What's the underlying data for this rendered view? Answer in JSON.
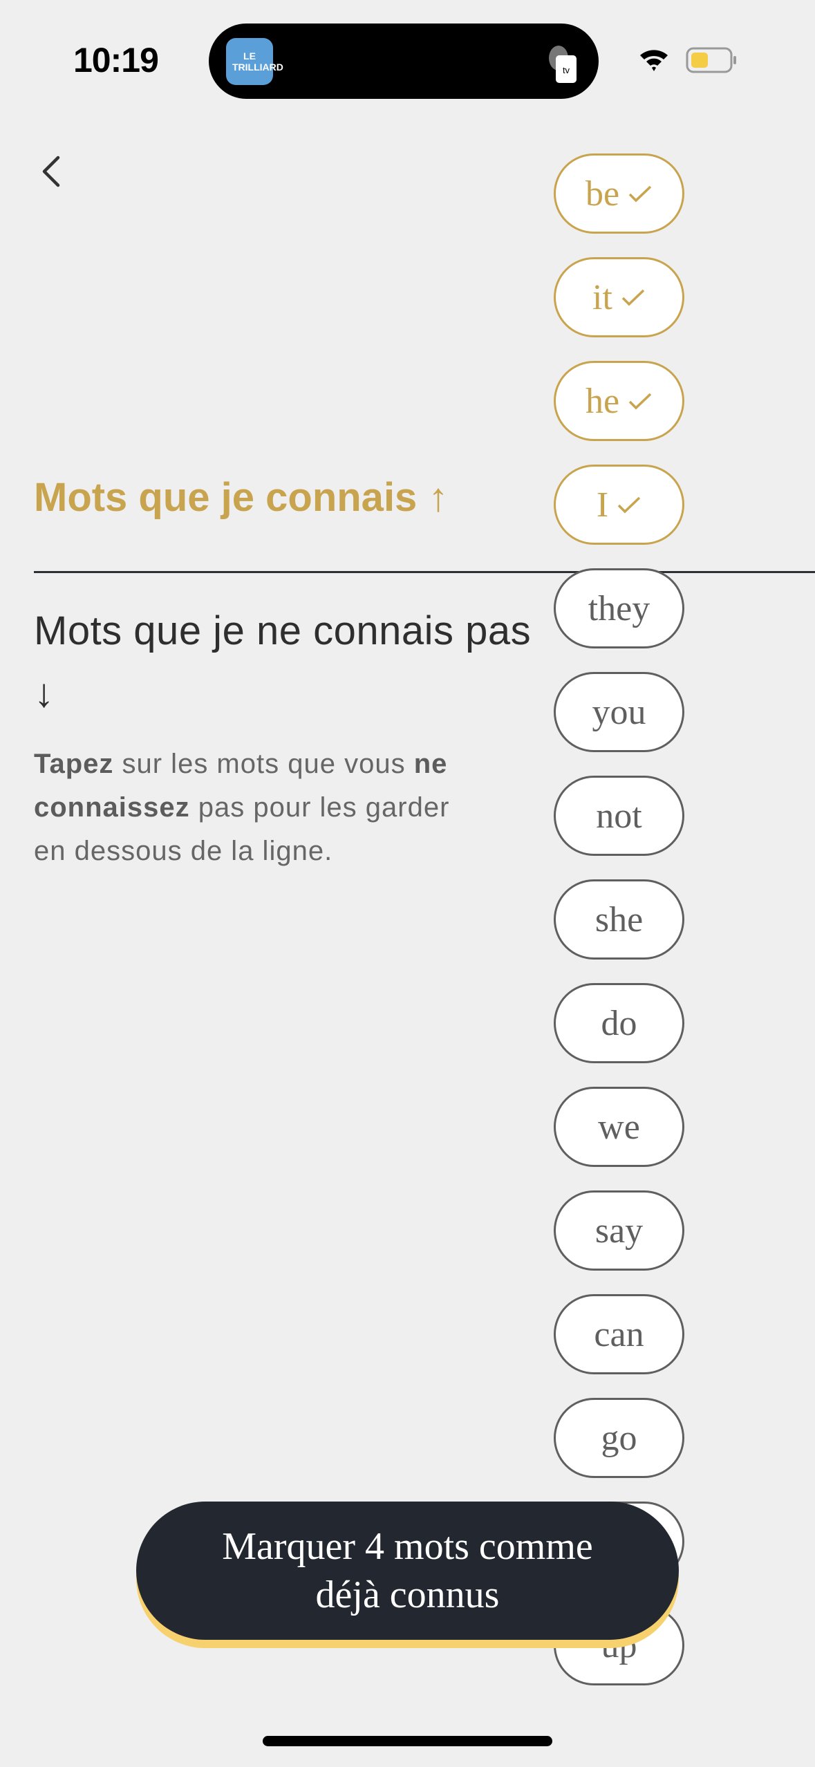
{
  "status_bar": {
    "time": "10:19",
    "app_icon_text": "LE TRILLIARD",
    "tv_badge": "tv"
  },
  "colors": {
    "accent": "#c9a44f",
    "dark": "#23272f",
    "button_shadow": "#f6d16d",
    "background": "#efefef"
  },
  "known_section": {
    "title": "Mots que je connais ↑"
  },
  "unknown_section": {
    "title": "Mots que je ne connais pas ↓",
    "instructions": {
      "b1": "Tapez",
      "t1": " sur les mots que vous ",
      "b2": "ne",
      "b3": "connaissez",
      "t2": " pas pour les garder",
      "t3": "en dessous de la ligne."
    }
  },
  "pills": [
    {
      "word": "be",
      "known": true
    },
    {
      "word": "it",
      "known": true
    },
    {
      "word": "he",
      "known": true
    },
    {
      "word": "I",
      "known": true
    },
    {
      "word": "they",
      "known": false
    },
    {
      "word": "you",
      "known": false
    },
    {
      "word": "not",
      "known": false
    },
    {
      "word": "she",
      "known": false
    },
    {
      "word": "do",
      "known": false
    },
    {
      "word": "we",
      "known": false
    },
    {
      "word": "say",
      "known": false
    },
    {
      "word": "can",
      "known": false
    },
    {
      "word": "go",
      "known": false
    },
    {
      "word": "",
      "known": false
    },
    {
      "word": "up",
      "known": false
    }
  ],
  "cta": {
    "line1": "Marquer 4 mots comme",
    "line2": "déjà connus"
  }
}
